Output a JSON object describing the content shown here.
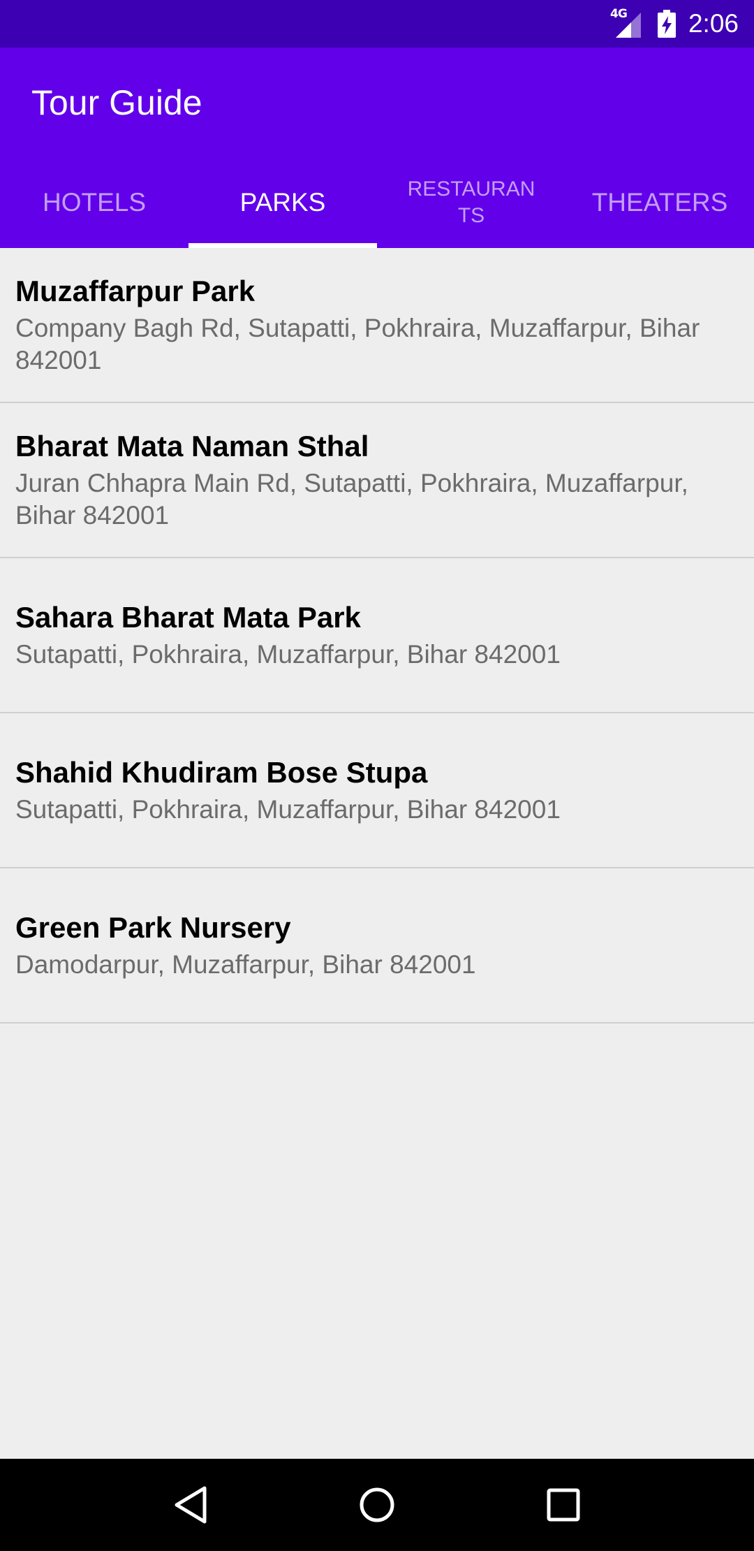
{
  "status_bar": {
    "network": "4G",
    "time": "2:06",
    "icons": [
      "signal-icon",
      "battery-charging-icon"
    ]
  },
  "app_bar": {
    "title": "Tour Guide"
  },
  "tabs": [
    {
      "label": "HOTELS",
      "active": false
    },
    {
      "label": "PARKS",
      "active": true
    },
    {
      "label": "RESTAURANTS",
      "active": false
    },
    {
      "label": "THEATERS",
      "active": false
    }
  ],
  "places": [
    {
      "name": "Muzaffarpur Park",
      "address": "Company Bagh Rd, Sutapatti, Pokhraira, Muzaffarpur, Bihar 842001"
    },
    {
      "name": "Bharat Mata Naman Sthal",
      "address": "Juran Chhapra Main Rd, Sutapatti, Pokhraira, Muzaffarpur, Bihar 842001"
    },
    {
      "name": "Sahara Bharat Mata Park",
      "address": "Sutapatti, Pokhraira, Muzaffarpur, Bihar 842001"
    },
    {
      "name": "Shahid Khudiram Bose Stupa",
      "address": "Sutapatti, Pokhraira, Muzaffarpur, Bihar 842001"
    },
    {
      "name": "Green Park Nursery",
      "address": "Damodarpur, Muzaffarpur, Bihar 842001"
    }
  ],
  "nav_bar": {
    "icons": [
      "back-icon",
      "home-icon",
      "recents-icon"
    ]
  },
  "colors": {
    "status_bar": "#3d00b3",
    "primary": "#6200ea",
    "background": "#eeeeee",
    "divider": "#cfcfcf",
    "secondary_text": "#6b6b6b"
  }
}
